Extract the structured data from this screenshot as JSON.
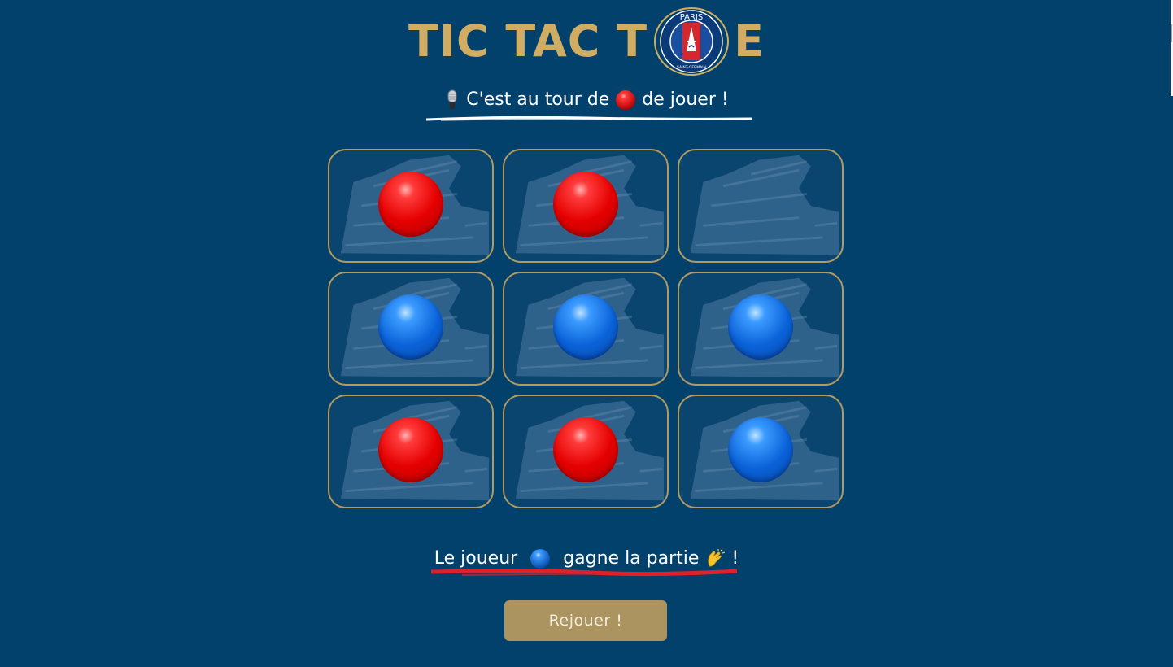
{
  "title": {
    "text_before_crest": "TIC TAC T",
    "text_after_crest": "E",
    "crest_text_top": "PARIS",
    "crest_text_bottom": "SAINT-GERMAIN"
  },
  "turn": {
    "prefix": "C'est au tour de",
    "suffix": "de jouer !",
    "current_player": "red",
    "icon": "microphone-icon"
  },
  "board": {
    "cells": [
      "red",
      "red",
      "",
      "blue",
      "blue",
      "blue",
      "red",
      "red",
      "blue"
    ]
  },
  "result": {
    "prefix": "Le joueur",
    "suffix": "gagne la partie",
    "end": "!",
    "winner": "blue",
    "icon": "clapping-hands-icon"
  },
  "replay_button": {
    "label": "Rejouer !"
  },
  "colors": {
    "background": "#01416b",
    "gold": "#d0ad63",
    "button": "#ab9460",
    "red_token": "#e50000",
    "blue_token": "#0a62d8",
    "underline_red": "#e0202a"
  }
}
